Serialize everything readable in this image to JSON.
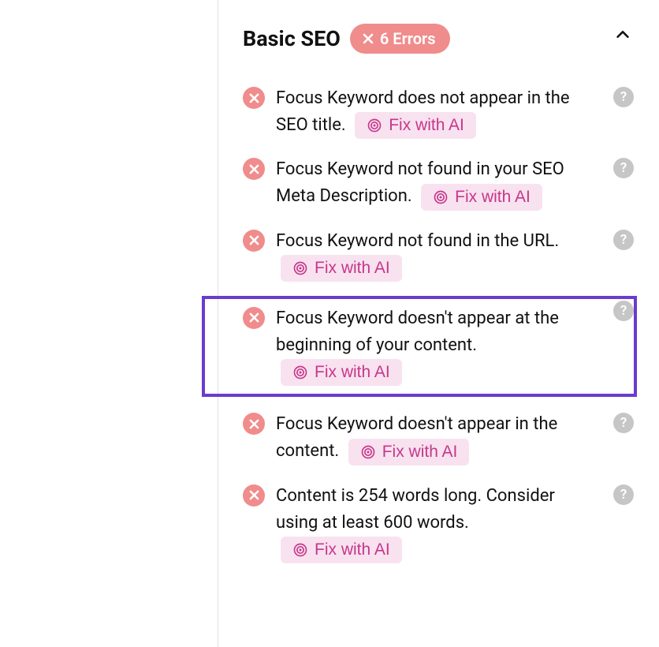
{
  "section": {
    "title": "Basic SEO",
    "badge": "6 Errors"
  },
  "fix_label": "Fix with AI",
  "help_label": "?",
  "items": [
    {
      "text": "Focus Keyword does not appear in the SEO title."
    },
    {
      "text": "Focus Keyword not found in your SEO Meta Description."
    },
    {
      "text": "Focus Keyword not found in the URL."
    },
    {
      "text": "Focus Keyword doesn't appear at the beginning of your content.",
      "highlight": true
    },
    {
      "text": "Focus Keyword doesn't appear in the content."
    },
    {
      "text": "Content is 254 words long. Consider using at least 600 words."
    }
  ]
}
